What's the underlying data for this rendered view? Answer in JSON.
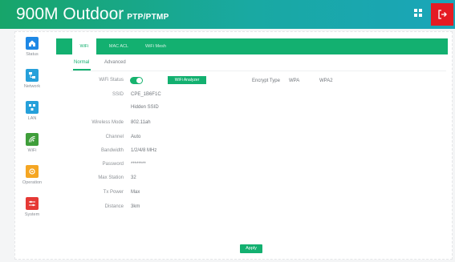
{
  "header": {
    "title": "900M Outdoor",
    "subtitle": "PTP/PTMP",
    "grid_icon": "grid-icon",
    "logout_icon": "logout-icon"
  },
  "sidebar": {
    "items": [
      {
        "label": "Status",
        "icon": "home-icon",
        "color": "#1e88e5"
      },
      {
        "label": "Network",
        "icon": "network-icon",
        "color": "#26a0da"
      },
      {
        "label": "LAN",
        "icon": "lan-icon",
        "color": "#26a0da"
      },
      {
        "label": "WiFi",
        "icon": "wifi-icon",
        "color": "#3f9e3a"
      },
      {
        "label": "Operation",
        "icon": "operation-icon",
        "color": "#f5a623"
      },
      {
        "label": "System",
        "icon": "system-icon",
        "color": "#e53935"
      }
    ]
  },
  "tabs": [
    {
      "label": "WiFi"
    },
    {
      "label": "MAC ACL"
    },
    {
      "label": "WiFi Mesh"
    }
  ],
  "subtabs": [
    {
      "label": "Normal"
    },
    {
      "label": "Advanced"
    }
  ],
  "form": {
    "wifi_status_label": "WiFi Status",
    "scan_button": "WiFi Analyzer",
    "encryption_label": "Encrypt Type",
    "encryption_options": [
      "WPA",
      "WPA2"
    ],
    "ssid_label": "SSID",
    "ssid_value": "CPE_1B6F1C",
    "ssid2_value": "Hidden SSID",
    "wireless_mode_label": "Wireless Mode",
    "wireless_mode_value": "802.11ah",
    "channel_label": "Channel",
    "channel_value": "Auto",
    "bandwidth_label": "Bandwidth",
    "bandwidth_value": "1/2/4/8 MHz",
    "password_label": "Password",
    "password_value": "********",
    "max_station_label": "Max Station",
    "max_station_value": "32",
    "tx_power_label": "Tx Power",
    "tx_power_value": "Max",
    "distance_label": "Distance",
    "distance_value": "3km"
  },
  "apply_label": "Apply"
}
